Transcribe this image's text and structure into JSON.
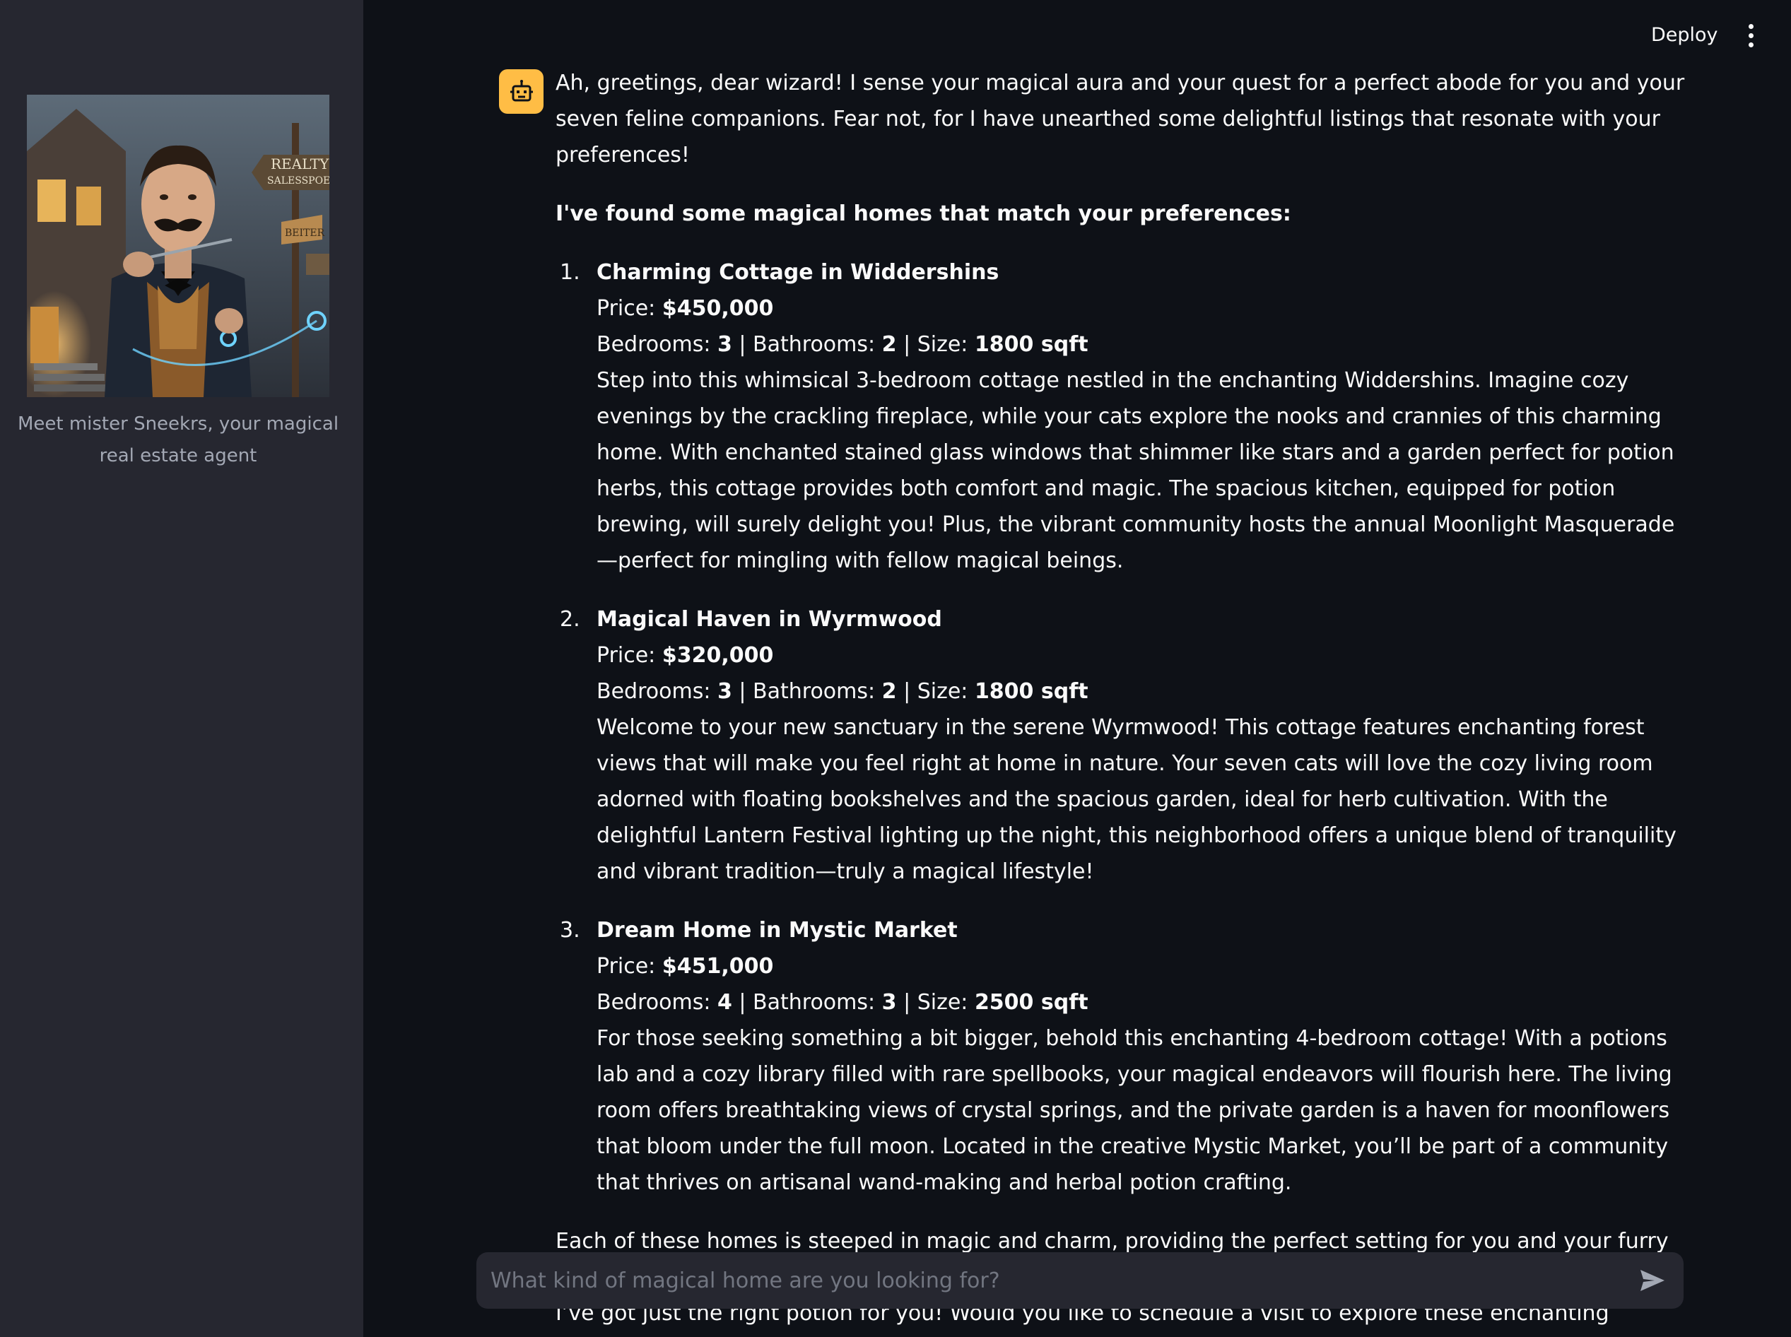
{
  "header": {
    "deploy_label": "Deploy",
    "menu_icon": "vertical-ellipsis-icon"
  },
  "sidebar": {
    "image_icon": "wizard-realtor-portrait",
    "caption": "Meet mister Sneekrs, your magical real estate agent"
  },
  "message": {
    "avatar_icon": "robot-icon",
    "avatar_color": "#ffbd45",
    "intro": "Ah, greetings, dear wizard! I sense your magical aura and your quest for a perfect abode for you and your seven feline companions. Fear not, for I have unearthed some delightful listings that resonate with your preferences!",
    "heading": "I've found some magical homes that match your preferences:",
    "listings": [
      {
        "number": "1.",
        "title": "Charming Cottage in Widdershins",
        "price_label": "Price: ",
        "price": "$450,000",
        "bedrooms_label": "Bedrooms: ",
        "bedrooms": "3",
        "bathrooms_label": " | Bathrooms: ",
        "bathrooms": "2",
        "size_label": " | Size: ",
        "size": "1800 sqft",
        "description": "Step into this whimsical 3-bedroom cottage nestled in the enchanting Widdershins. Imagine cozy evenings by the crackling fireplace, while your cats explore the nooks and crannies of this charming home. With enchanted stained glass windows that shimmer like stars and a garden perfect for potion herbs, this cottage provides both comfort and magic. The spacious kitchen, equipped for potion brewing, will surely delight you! Plus, the vibrant community hosts the annual Moonlight Masquerade—perfect for mingling with fellow magical beings."
      },
      {
        "number": "2.",
        "title": "Magical Haven in Wyrmwood",
        "price_label": "Price: ",
        "price": "$320,000",
        "bedrooms_label": "Bedrooms: ",
        "bedrooms": "3",
        "bathrooms_label": " | Bathrooms: ",
        "bathrooms": "2",
        "size_label": " | Size: ",
        "size": "1800 sqft",
        "description": "Welcome to your new sanctuary in the serene Wyrmwood! This cottage features enchanting forest views that will make you feel right at home in nature. Your seven cats will love the cozy living room adorned with floating bookshelves and the spacious garden, ideal for herb cultivation. With the delightful Lantern Festival lighting up the night, this neighborhood offers a unique blend of tranquility and vibrant tradition—truly a magical lifestyle!"
      },
      {
        "number": "3.",
        "title": "Dream Home in Mystic Market",
        "price_label": "Price: ",
        "price": "$451,000",
        "bedrooms_label": "Bedrooms: ",
        "bedrooms": "4",
        "bathrooms_label": " | Bathrooms: ",
        "bathrooms": "3",
        "size_label": " | Size: ",
        "size": "2500 sqft",
        "description": "For those seeking something a bit bigger, behold this enchanting 4-bedroom cottage! With a potions lab and a cozy library filled with rare spellbooks, your magical endeavors will flourish here. The living room offers breathtaking views of crystal springs, and the private garden is a haven for moonflowers that bloom under the full moon. Located in the creative Mystic Market, you’ll be part of a community that thrives on artisanal wand-making and herbal potion crafting."
      }
    ],
    "closing": "Each of these homes is steeped in magic and charm, providing the perfect setting for you and your furry friends. Whether you seek a snug little cottage or a larger space to accommodate your magical lifestyle, I’ve got just the right potion for you! Would you like to schedule a visit to explore these enchanting properties? 🌟🏡"
  },
  "chat_input": {
    "placeholder": "What kind of magical home are you looking for?",
    "value": "",
    "send_icon": "send-arrow-icon"
  }
}
